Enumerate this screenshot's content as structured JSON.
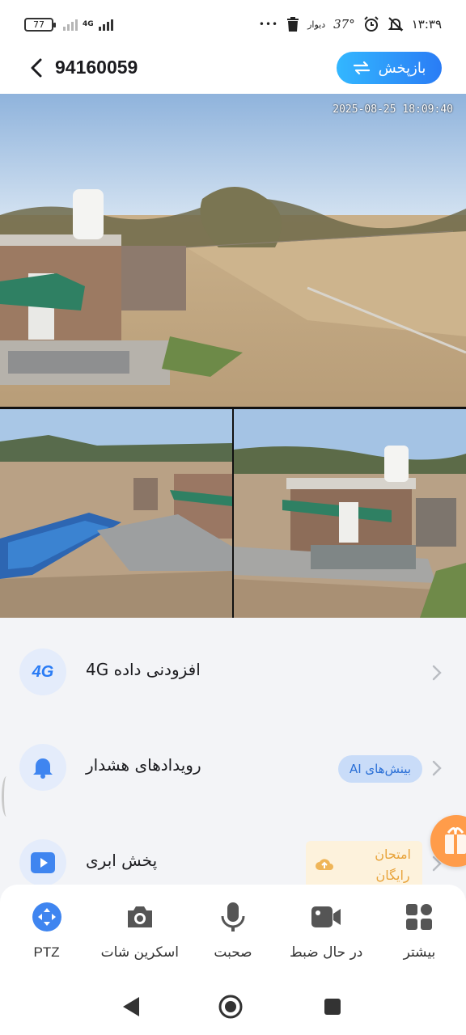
{
  "status_bar": {
    "battery": "77",
    "network": "4G",
    "dots": "•••",
    "weather_label": "دیوار",
    "temperature": "37°",
    "time": "۱۳:۳۹"
  },
  "header": {
    "title": "94160059",
    "playback_label": "بازپخش",
    "playback_icon": "swap-arrows-icon"
  },
  "camera": {
    "timestamp": "2025-08-25 18:09:40"
  },
  "list": {
    "items": [
      {
        "icon": "4g-icon",
        "icon_text": "4G",
        "label": "افزودنی داده 4G"
      },
      {
        "icon": "bell-icon",
        "label": "رویدادهای هشدار",
        "pill": "بینش‌های AI"
      },
      {
        "icon": "play-icon",
        "label": "پخش ابری",
        "trial_line1": "امتحان",
        "trial_line2": "رایگان"
      }
    ]
  },
  "toolbar": {
    "items": [
      {
        "icon": "ptz-icon",
        "label": "PTZ"
      },
      {
        "icon": "camera-icon",
        "label": "اسکرین شات"
      },
      {
        "icon": "microphone-icon",
        "label": "صحبت"
      },
      {
        "icon": "video-icon",
        "label": "در حال ضبط"
      },
      {
        "icon": "grid-icon",
        "label": "بیشتر"
      }
    ]
  },
  "colors": {
    "accent": "#2a7cf5",
    "icon_bg": "#e4ecfb",
    "trial_bg": "#fdf2dc",
    "trial_text": "#e8a33a"
  }
}
